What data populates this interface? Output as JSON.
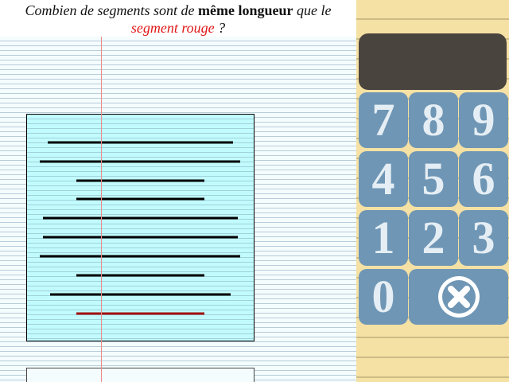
{
  "question": {
    "part1": "Combien de segments sont de ",
    "emphasis": "même longueur",
    "part2": " que le",
    "highlight": "segment rouge",
    "part3": " ?"
  },
  "keypad": {
    "keys": [
      "7",
      "8",
      "9",
      "4",
      "5",
      "6",
      "1",
      "2",
      "3",
      "0"
    ],
    "clear_icon": "clear-x-circle-icon"
  },
  "display": {
    "value": ""
  },
  "colors": {
    "highlight_segment": "#a01010",
    "segment": "#000000",
    "key_background": "#6f96b5",
    "display_background": "#4a443e",
    "panel_background": "#f5e1a4"
  }
}
